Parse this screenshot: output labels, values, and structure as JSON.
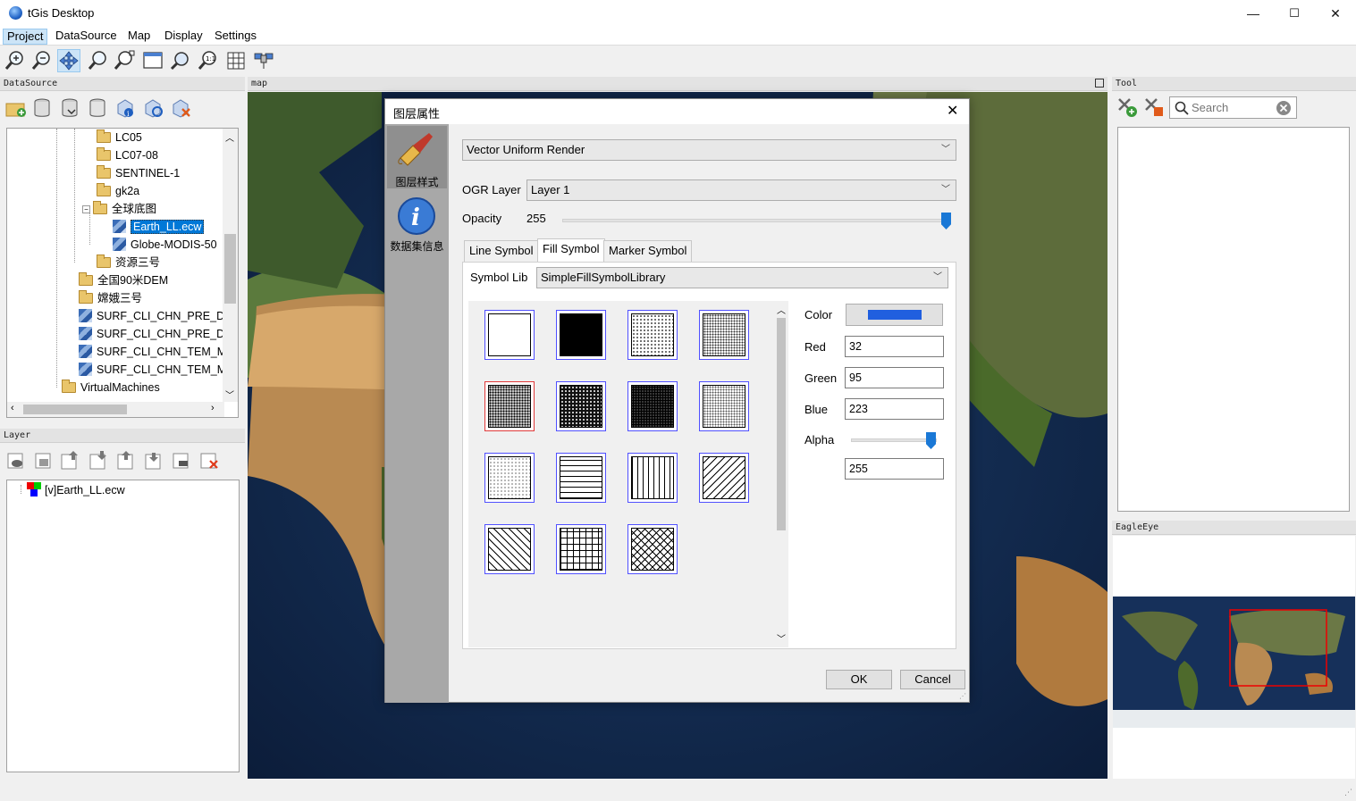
{
  "app": {
    "title": "tGis Desktop",
    "minimize": "—",
    "maximize": "☐",
    "close": "✕"
  },
  "menu": [
    "Project",
    "DataSource",
    "Map",
    "Display",
    "Settings"
  ],
  "toolbar_icons": [
    "zoom-in-icon",
    "zoom-out-icon",
    "pan-icon",
    "zoom-select-icon",
    "zoom-extent-icon",
    "full-extent-icon",
    "zoom-layer-icon",
    "zoom-original-icon",
    "grid-icon",
    "satellite-icon"
  ],
  "datasource": {
    "header": "DataSource",
    "tree": [
      {
        "label": "LC05",
        "kind": "folder",
        "level": 2
      },
      {
        "label": "LC07-08",
        "kind": "folder",
        "level": 2
      },
      {
        "label": "SENTINEL-1",
        "kind": "folder",
        "level": 2
      },
      {
        "label": "gk2a",
        "kind": "folder",
        "level": 2
      },
      {
        "label": "全球底图",
        "kind": "folder-open",
        "level": 2
      },
      {
        "label": "Earth_LL.ecw",
        "kind": "raster",
        "level": 3,
        "selected": true
      },
      {
        "label": "Globe-MODIS-50",
        "kind": "raster",
        "level": 3
      },
      {
        "label": "资源三号",
        "kind": "folder",
        "level": 2
      },
      {
        "label": "全国90米DEM",
        "kind": "folder",
        "level": 1
      },
      {
        "label": "嫦娥三号",
        "kind": "folder",
        "level": 1
      },
      {
        "label": "SURF_CLI_CHN_PRE_DAY",
        "kind": "raster",
        "level": 1
      },
      {
        "label": "SURF_CLI_CHN_PRE_DAY",
        "kind": "raster",
        "level": 1
      },
      {
        "label": "SURF_CLI_CHN_TEM_MC",
        "kind": "raster",
        "level": 1
      },
      {
        "label": "SURF_CLI_CHN_TEM_MC",
        "kind": "raster",
        "level": 1
      },
      {
        "label": "VirtualMachines",
        "kind": "folder",
        "level": 0
      }
    ]
  },
  "layer": {
    "header": "Layer",
    "items": [
      "[v]Earth_LL.ecw"
    ]
  },
  "map": {
    "header": "map"
  },
  "tool": {
    "header": "Tool",
    "search_placeholder": "Search"
  },
  "eagle": {
    "header": "EagleEye"
  },
  "dialog": {
    "title": "图层属性",
    "side_items": [
      "图层样式",
      "数据集信息"
    ],
    "renderer": "Vector Uniform Render",
    "ogr_layer_label": "OGR Layer",
    "ogr_layer_value": "Layer 1",
    "opacity_label": "Opacity",
    "opacity_value": "255",
    "opacity_level": 1.0,
    "tabs": [
      "Line Symbol",
      "Fill Symbol",
      "Marker Symbol"
    ],
    "active_tab": "Fill Symbol",
    "symbol_lib_label": "Symbol Lib",
    "symbol_lib_value": "SimpleFillSymbolLibrary",
    "color_label": "Color",
    "color_hex": "#205fdf",
    "red_label": "Red",
    "red": "32",
    "green_label": "Green",
    "green": "95",
    "blue_label": "Blue",
    "blue": "223",
    "alpha_label": "Alpha",
    "alpha": "255",
    "alpha_level": 1.0,
    "ok": "OK",
    "cancel": "Cancel"
  }
}
